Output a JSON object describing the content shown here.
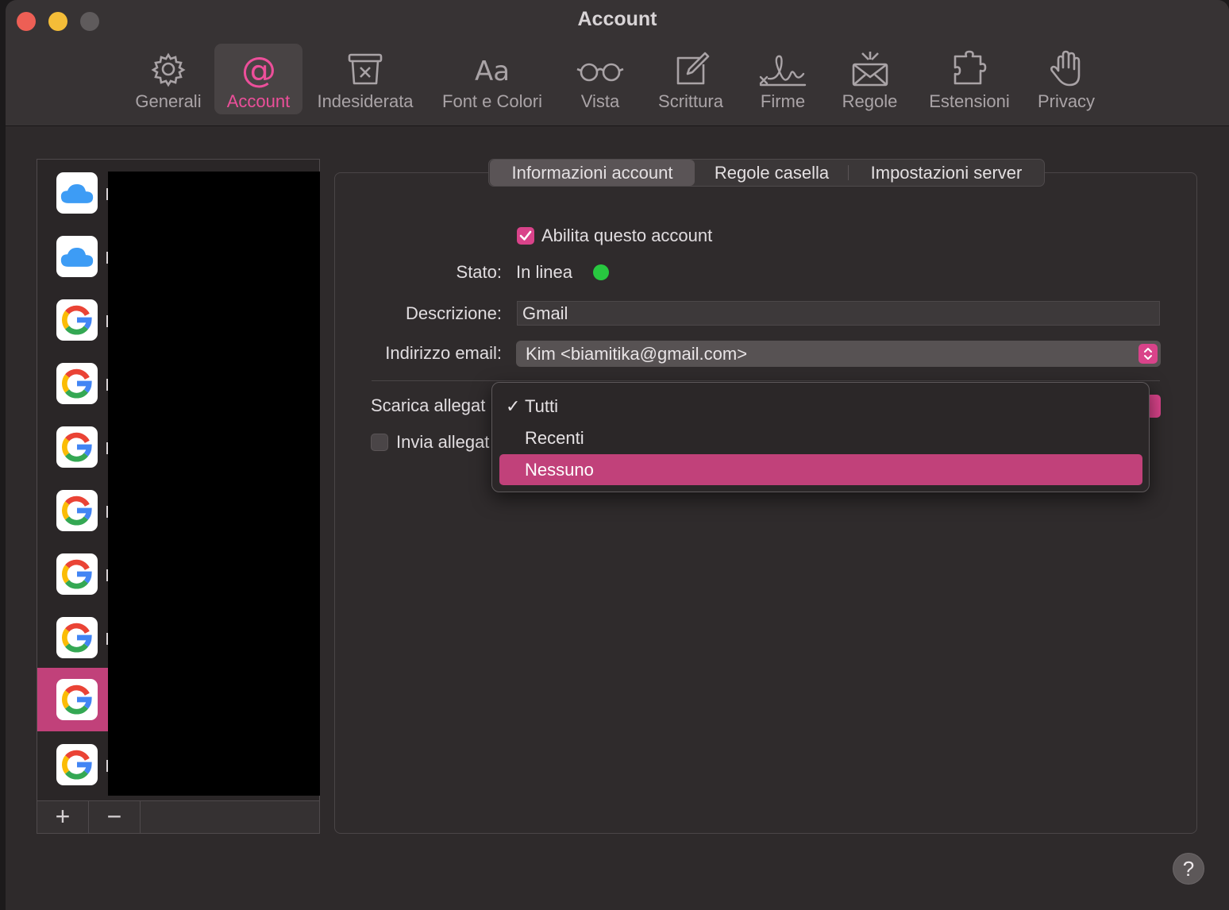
{
  "window": {
    "title": "Account"
  },
  "toolbar": {
    "items": [
      {
        "label": "Generali",
        "icon": "gear-icon"
      },
      {
        "label": "Account",
        "icon": "at-sign-icon",
        "active": true
      },
      {
        "label": "Indesiderata",
        "icon": "junk-bin-icon"
      },
      {
        "label": "Font e Colori",
        "icon": "text-aa-icon"
      },
      {
        "label": "Vista",
        "icon": "glasses-icon"
      },
      {
        "label": "Scrittura",
        "icon": "compose-pencil-icon"
      },
      {
        "label": "Firme",
        "icon": "signature-icon"
      },
      {
        "label": "Regole",
        "icon": "envelope-rules-icon"
      },
      {
        "label": "Estensioni",
        "icon": "puzzle-piece-icon"
      },
      {
        "label": "Privacy",
        "icon": "hand-icon"
      }
    ],
    "icon_glyph_aa": "Aa",
    "icon_glyph_at": "@"
  },
  "sidebar": {
    "accounts": [
      {
        "type": "icloud",
        "icon": "icloud-icon"
      },
      {
        "type": "icloud",
        "icon": "icloud-icon"
      },
      {
        "type": "google",
        "icon": "google-icon"
      },
      {
        "type": "google",
        "icon": "google-icon"
      },
      {
        "type": "google",
        "icon": "google-icon"
      },
      {
        "type": "google",
        "icon": "google-icon"
      },
      {
        "type": "google",
        "icon": "google-icon"
      },
      {
        "type": "google",
        "icon": "google-icon"
      },
      {
        "type": "google",
        "icon": "google-icon",
        "selected": true
      },
      {
        "type": "google",
        "icon": "google-icon"
      }
    ],
    "add_label": "+",
    "remove_label": "−"
  },
  "tabs": {
    "items": [
      {
        "label": "Informazioni account",
        "active": true
      },
      {
        "label": "Regole casella"
      },
      {
        "label": "Impostazioni server"
      }
    ]
  },
  "form": {
    "enable_label": "Abilita questo account",
    "enable_checked": true,
    "status_label": "Stato:",
    "status_value": "In linea",
    "status_color": "#28c840",
    "description_label": "Descrizione:",
    "description_value": "Gmail",
    "email_label": "Indirizzo email:",
    "email_value": "Kim <biamitika@gmail.com>",
    "download_label": "Scarica allegat",
    "send_label": "Invia allegat",
    "send_checked": false
  },
  "dropdown": {
    "options": [
      {
        "label": "Tutti",
        "checked": true
      },
      {
        "label": "Recenti"
      },
      {
        "label": "Nessuno",
        "highlighted": true
      }
    ],
    "check_glyph": "✓"
  },
  "help_label": "?",
  "colors": {
    "accent": "#d9438a",
    "selection": "#c1417a",
    "accent_text": "#ec4f9a"
  }
}
